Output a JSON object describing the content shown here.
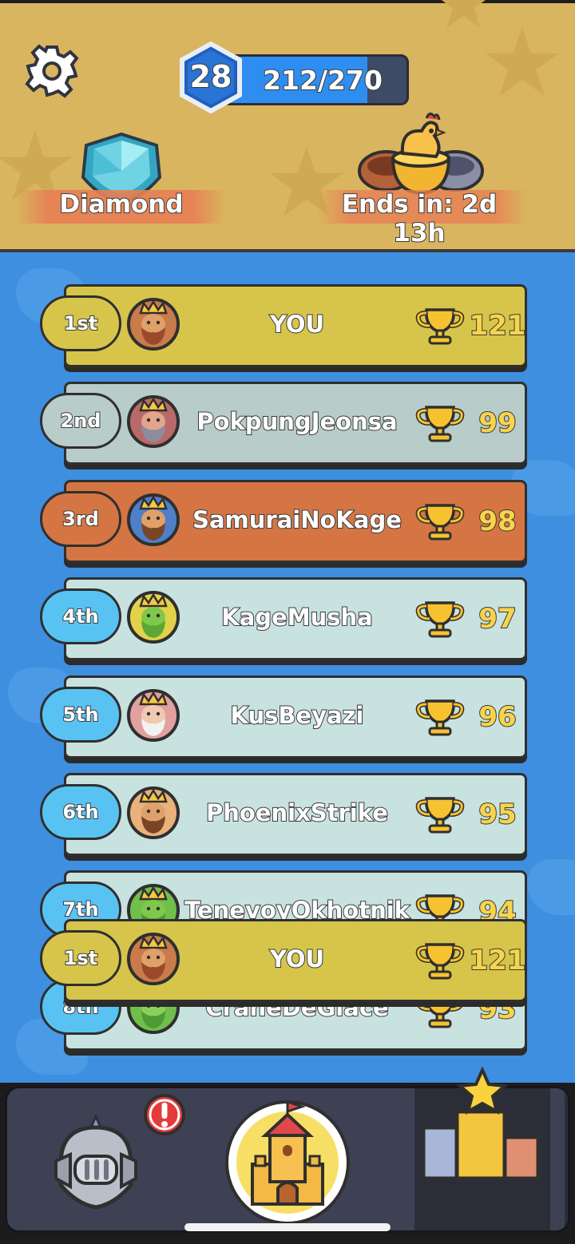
{
  "header": {
    "level": "28",
    "xp_text": "212/270",
    "xp_fraction": 0.785,
    "league_name": "Diamond",
    "ends_in": "Ends in: 2d 13h"
  },
  "colors": {
    "header_bg": "#d9b55f",
    "board_bg": "#3e8fdf",
    "gold_card": "#d6c54a",
    "silver_card": "#b8ccc9",
    "bronze_card": "#d47543",
    "plain_card": "#c8e2e0",
    "plain_pill": "#58c3f3",
    "score_yellow": "#f8d44a"
  },
  "leaderboard": {
    "rows": [
      {
        "rank": "1st",
        "name": "YOU",
        "score": "121",
        "tier": "gold"
      },
      {
        "rank": "2nd",
        "name": "PokpungJeonsa",
        "score": "99",
        "tier": "silver"
      },
      {
        "rank": "3rd",
        "name": "SamuraiNoKage",
        "score": "98",
        "tier": "bronze"
      },
      {
        "rank": "4th",
        "name": "KageMusha",
        "score": "97",
        "tier": "plain"
      },
      {
        "rank": "5th",
        "name": "KusBeyazi",
        "score": "96",
        "tier": "plain"
      },
      {
        "rank": "6th",
        "name": "PhoenixStrike",
        "score": "95",
        "tier": "plain"
      },
      {
        "rank": "7th",
        "name": "TenevoyOkhotnik",
        "score": "94",
        "tier": "plain"
      },
      {
        "rank": "8th",
        "name": "CraneDeGlace",
        "score": "93",
        "tier": "plain"
      }
    ],
    "pinned": {
      "rank": "1st",
      "name": "YOU",
      "score": "121",
      "tier": "gold"
    }
  },
  "nav": {
    "items": [
      {
        "id": "heroes",
        "icon": "knight-helmet-icon",
        "alert": true
      },
      {
        "id": "castle",
        "icon": "castle-icon"
      },
      {
        "id": "leaderboard",
        "icon": "podium-icon",
        "selected": true
      }
    ]
  }
}
